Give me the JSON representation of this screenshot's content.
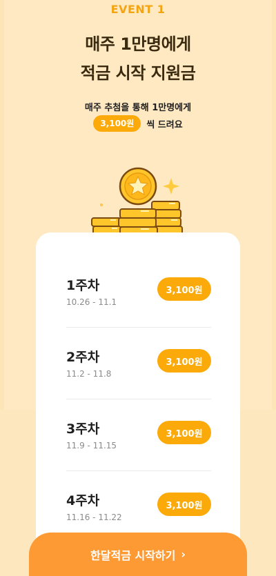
{
  "event_tag": "EVENT 1",
  "headline": {
    "line1": "매주 1만명에게",
    "line2": "적금 시작 지원금"
  },
  "subtext": "매주 추첨을 통해 1만명에게",
  "amount": {
    "value": "3,100원",
    "suffix": "씩 드려요"
  },
  "weeks": [
    {
      "title": "1주차",
      "dates": "10.26 - 11.1",
      "amount": "3,100원"
    },
    {
      "title": "2주차",
      "dates": "11.2 - 11.8",
      "amount": "3,100원"
    },
    {
      "title": "3주차",
      "dates": "11.9 - 11.15",
      "amount": "3,100원"
    },
    {
      "title": "4주차",
      "dates": "11.16 - 11.22",
      "amount": "3,100원"
    }
  ],
  "cta": {
    "label": "한달적금 시작하기",
    "chevron": "›"
  },
  "colors": {
    "accent": "#fbaa0a",
    "cta": "#fd9a34",
    "background": "#fde5b8"
  },
  "icons": [
    "coin-stack-icon",
    "star-coin-icon",
    "sparkle-icon",
    "chevron-right-icon"
  ]
}
